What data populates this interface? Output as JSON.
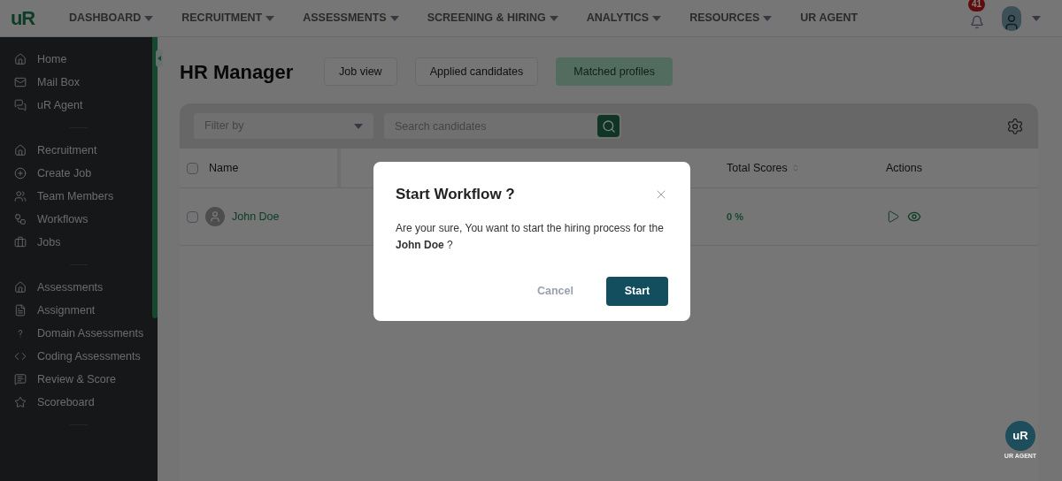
{
  "navbar": {
    "logo": "uR",
    "menu": [
      {
        "label": "DASHBOARD",
        "dropdown": true
      },
      {
        "label": "RECRUITMENT",
        "dropdown": true
      },
      {
        "label": "ASSESSMENTS",
        "dropdown": true
      },
      {
        "label": "SCREENING & HIRING",
        "dropdown": true
      },
      {
        "label": "ANALYTICS",
        "dropdown": true
      },
      {
        "label": "RESOURCES",
        "dropdown": true
      },
      {
        "label": "UR AGENT",
        "dropdown": false
      }
    ],
    "notifications": "41"
  },
  "sidebar": {
    "groups": [
      [
        {
          "label": "Home"
        },
        {
          "label": "Mail Box"
        },
        {
          "label": "uR Agent"
        }
      ],
      [
        {
          "label": "Recruitment"
        },
        {
          "label": "Create Job"
        },
        {
          "label": "Team Members"
        },
        {
          "label": "Workflows"
        },
        {
          "label": "Jobs"
        }
      ],
      [
        {
          "label": "Assessments"
        },
        {
          "label": "Assignment"
        },
        {
          "label": "Domain Assessments"
        },
        {
          "label": "Coding Assessments"
        },
        {
          "label": "Review & Score"
        },
        {
          "label": "Scoreboard"
        }
      ]
    ]
  },
  "page": {
    "title": "HR Manager",
    "tabs": [
      {
        "label": "Job view",
        "selected": false
      },
      {
        "label": "Applied candidates",
        "selected": false
      },
      {
        "label": "Matched profiles",
        "selected": true
      }
    ]
  },
  "table": {
    "select_all_checked": false,
    "filter": {
      "placeholder": "Filter by"
    },
    "search": {
      "placeholder": "Search candidates"
    },
    "columns": [
      {
        "label": "Name",
        "sortable": false
      },
      {
        "label": "Total Scores",
        "sortable": true
      },
      {
        "label": "Actions",
        "sortable": false
      }
    ],
    "rows": [
      {
        "checked": false,
        "name": "John Doe",
        "score": "0 %"
      }
    ]
  },
  "modal": {
    "title": "Start Workflow ?",
    "message": "Are your sure, You want to start the hiring process for the **John Doe** ?",
    "cancel": "Cancel",
    "confirm": "Start"
  },
  "agent_badge": {
    "logo": "uR",
    "caption": "UR AGENT"
  }
}
